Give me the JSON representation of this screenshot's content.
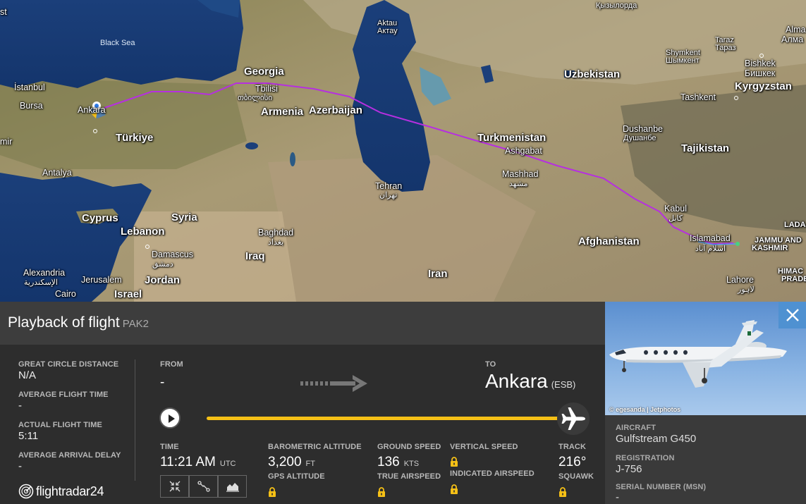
{
  "map": {
    "sea_labels": {
      "black_sea": "Black Sea"
    },
    "countries": {
      "georgia": "Georgia",
      "armenia": "Armenia",
      "azerbaijan": "Azerbaijan",
      "turkiye": "Türkiye",
      "turkmenistan": "Turkmenistan",
      "uzbekistan": "Uzbekistan",
      "tajikistan": "Tajikistan",
      "kyrgyzstan": "Kyrgyzstan",
      "afghanistan": "Afghanistan",
      "cyprus": "Cyprus",
      "lebanon": "Lebanon",
      "syria": "Syria",
      "iraq": "Iraq",
      "iran": "Iran",
      "jordan": "Jordan",
      "israel": "Israel",
      "jammu_kashmir_1": "JAMMU AND",
      "jammu_kashmir_2": "KASHMIR",
      "himachal": "HIMAC",
      "himachal2": "PRADE",
      "ladakh": "LADA"
    },
    "cities": {
      "istanbul": "İstanbul",
      "bursa": "Bursa",
      "ankara": "Ankara",
      "izmir": "mir",
      "antalya": "Antalya",
      "tbilisi": "Tbilisi",
      "tbilisi_local": "თბილისი",
      "aktau": "Aktau",
      "aktau_local": "Актау",
      "ashgabat": "Ashgabat",
      "mashhad": "Mashhad",
      "mashhad_local": "مشهد",
      "tehran": "Tehran",
      "tehran_local": "تهران",
      "baghdad": "Baghdad",
      "baghdad_local": "بغداد",
      "damascus": "Damascus",
      "damascus_local": "دمشق",
      "alexandria": "Alexandria",
      "alexandria_local": "الإسكندرية",
      "jerusalem": "Jerusalem",
      "cairo": "Cairo",
      "kabul": "Kabul",
      "kabul_local": "کابل",
      "islamabad": "Islamabad",
      "islamabad_local": "اسلام آباد",
      "lahore": "Lahore",
      "lahore_local": "لاہور",
      "dushanbe": "Dushanbe",
      "dushanbe_local": "Душанбе",
      "tashkent": "Tashkent",
      "shymkent": "Shymkent",
      "shymkent_local": "Шымкент",
      "taraz": "Taraz",
      "taraz_local": "Тараз",
      "bishkek": "Bishkek",
      "bishkek_local": "Бишкек",
      "almaty": "Alma",
      "almaty_local": "Алма",
      "kyzylorda_local": "Қызылорда",
      "st": "st"
    }
  },
  "panel": {
    "title": "Playback of flight",
    "callsign": "PAK2",
    "great_circle_label": "GREAT CIRCLE DISTANCE",
    "great_circle_value": "N/A",
    "avg_flight_time_label": "AVERAGE FLIGHT TIME",
    "avg_flight_time_value": "-",
    "actual_flight_time_label": "ACTUAL FLIGHT TIME",
    "actual_flight_time_value": "5:11",
    "avg_arrival_delay_label": "AVERAGE ARRIVAL DELAY",
    "avg_arrival_delay_value": "-",
    "from_label": "FROM",
    "from_value": "-",
    "to_label": "TO",
    "to_city": "Ankara",
    "to_code": "(ESB)",
    "progress": 1.0,
    "time_label": "TIME",
    "time_value": "11:21 AM",
    "time_unit": "UTC",
    "baro_alt_label": "BAROMETRIC ALTITUDE",
    "baro_alt_value": "3,200",
    "baro_alt_unit": "FT",
    "gps_alt_label": "GPS ALTITUDE",
    "ground_speed_label": "GROUND SPEED",
    "ground_speed_value": "136",
    "ground_speed_unit": "KTS",
    "true_airspeed_label": "TRUE AIRSPEED",
    "vertical_speed_label": "VERTICAL SPEED",
    "indicated_airspeed_label": "INDICATED AIRSPEED",
    "track_label": "TRACK",
    "track_value": "216°",
    "squawk_label": "SQUAWK",
    "brand": "flightradar24"
  },
  "aircraft": {
    "photo_credit": "© egesanda | Jetphotos",
    "aircraft_label": "AIRCRAFT",
    "aircraft_value": "Gulfstream G450",
    "registration_label": "REGISTRATION",
    "registration_value": "J-756",
    "serial_label": "SERIAL NUMBER (MSN)",
    "serial_value": "-"
  },
  "colors": {
    "track": "#b62fe0",
    "progress": "#f5c016",
    "close": "#4f91d1"
  }
}
